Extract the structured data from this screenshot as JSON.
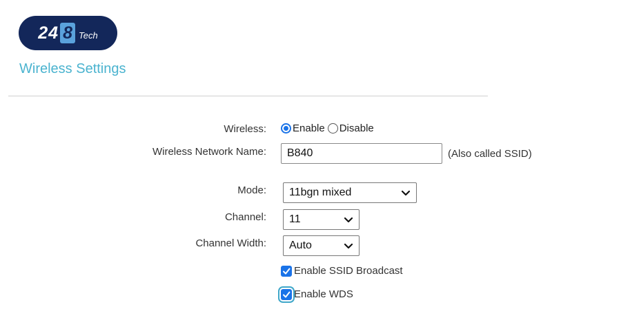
{
  "brand": {
    "num_a": "24",
    "num_b": "8",
    "suffix": "Tech"
  },
  "page_title": "Wireless Settings",
  "form": {
    "wireless": {
      "label": "Wireless:",
      "options": [
        "Enable",
        "Disable"
      ],
      "selected": "Enable"
    },
    "network_name": {
      "label": "Wireless Network Name:",
      "value": "B840",
      "hint": "(Also called SSID)"
    },
    "mode": {
      "label": "Mode:",
      "value": "11bgn mixed"
    },
    "channel": {
      "label": "Channel:",
      "value": "11"
    },
    "channel_width": {
      "label": "Channel Width:",
      "value": "Auto"
    },
    "ssid_broadcast": {
      "label": "Enable SSID Broadcast",
      "checked": true
    },
    "wds": {
      "label": "Enable WDS",
      "checked": true
    }
  },
  "colors": {
    "accent": "#1a73e8",
    "title": "#4ab3cf",
    "logo_bg": "#13275a",
    "logo_accent": "#5aa2dc"
  },
  "icons": [
    "radio-checked-icon",
    "radio-unchecked-icon",
    "chevron-down-icon",
    "checkmark-icon"
  ]
}
